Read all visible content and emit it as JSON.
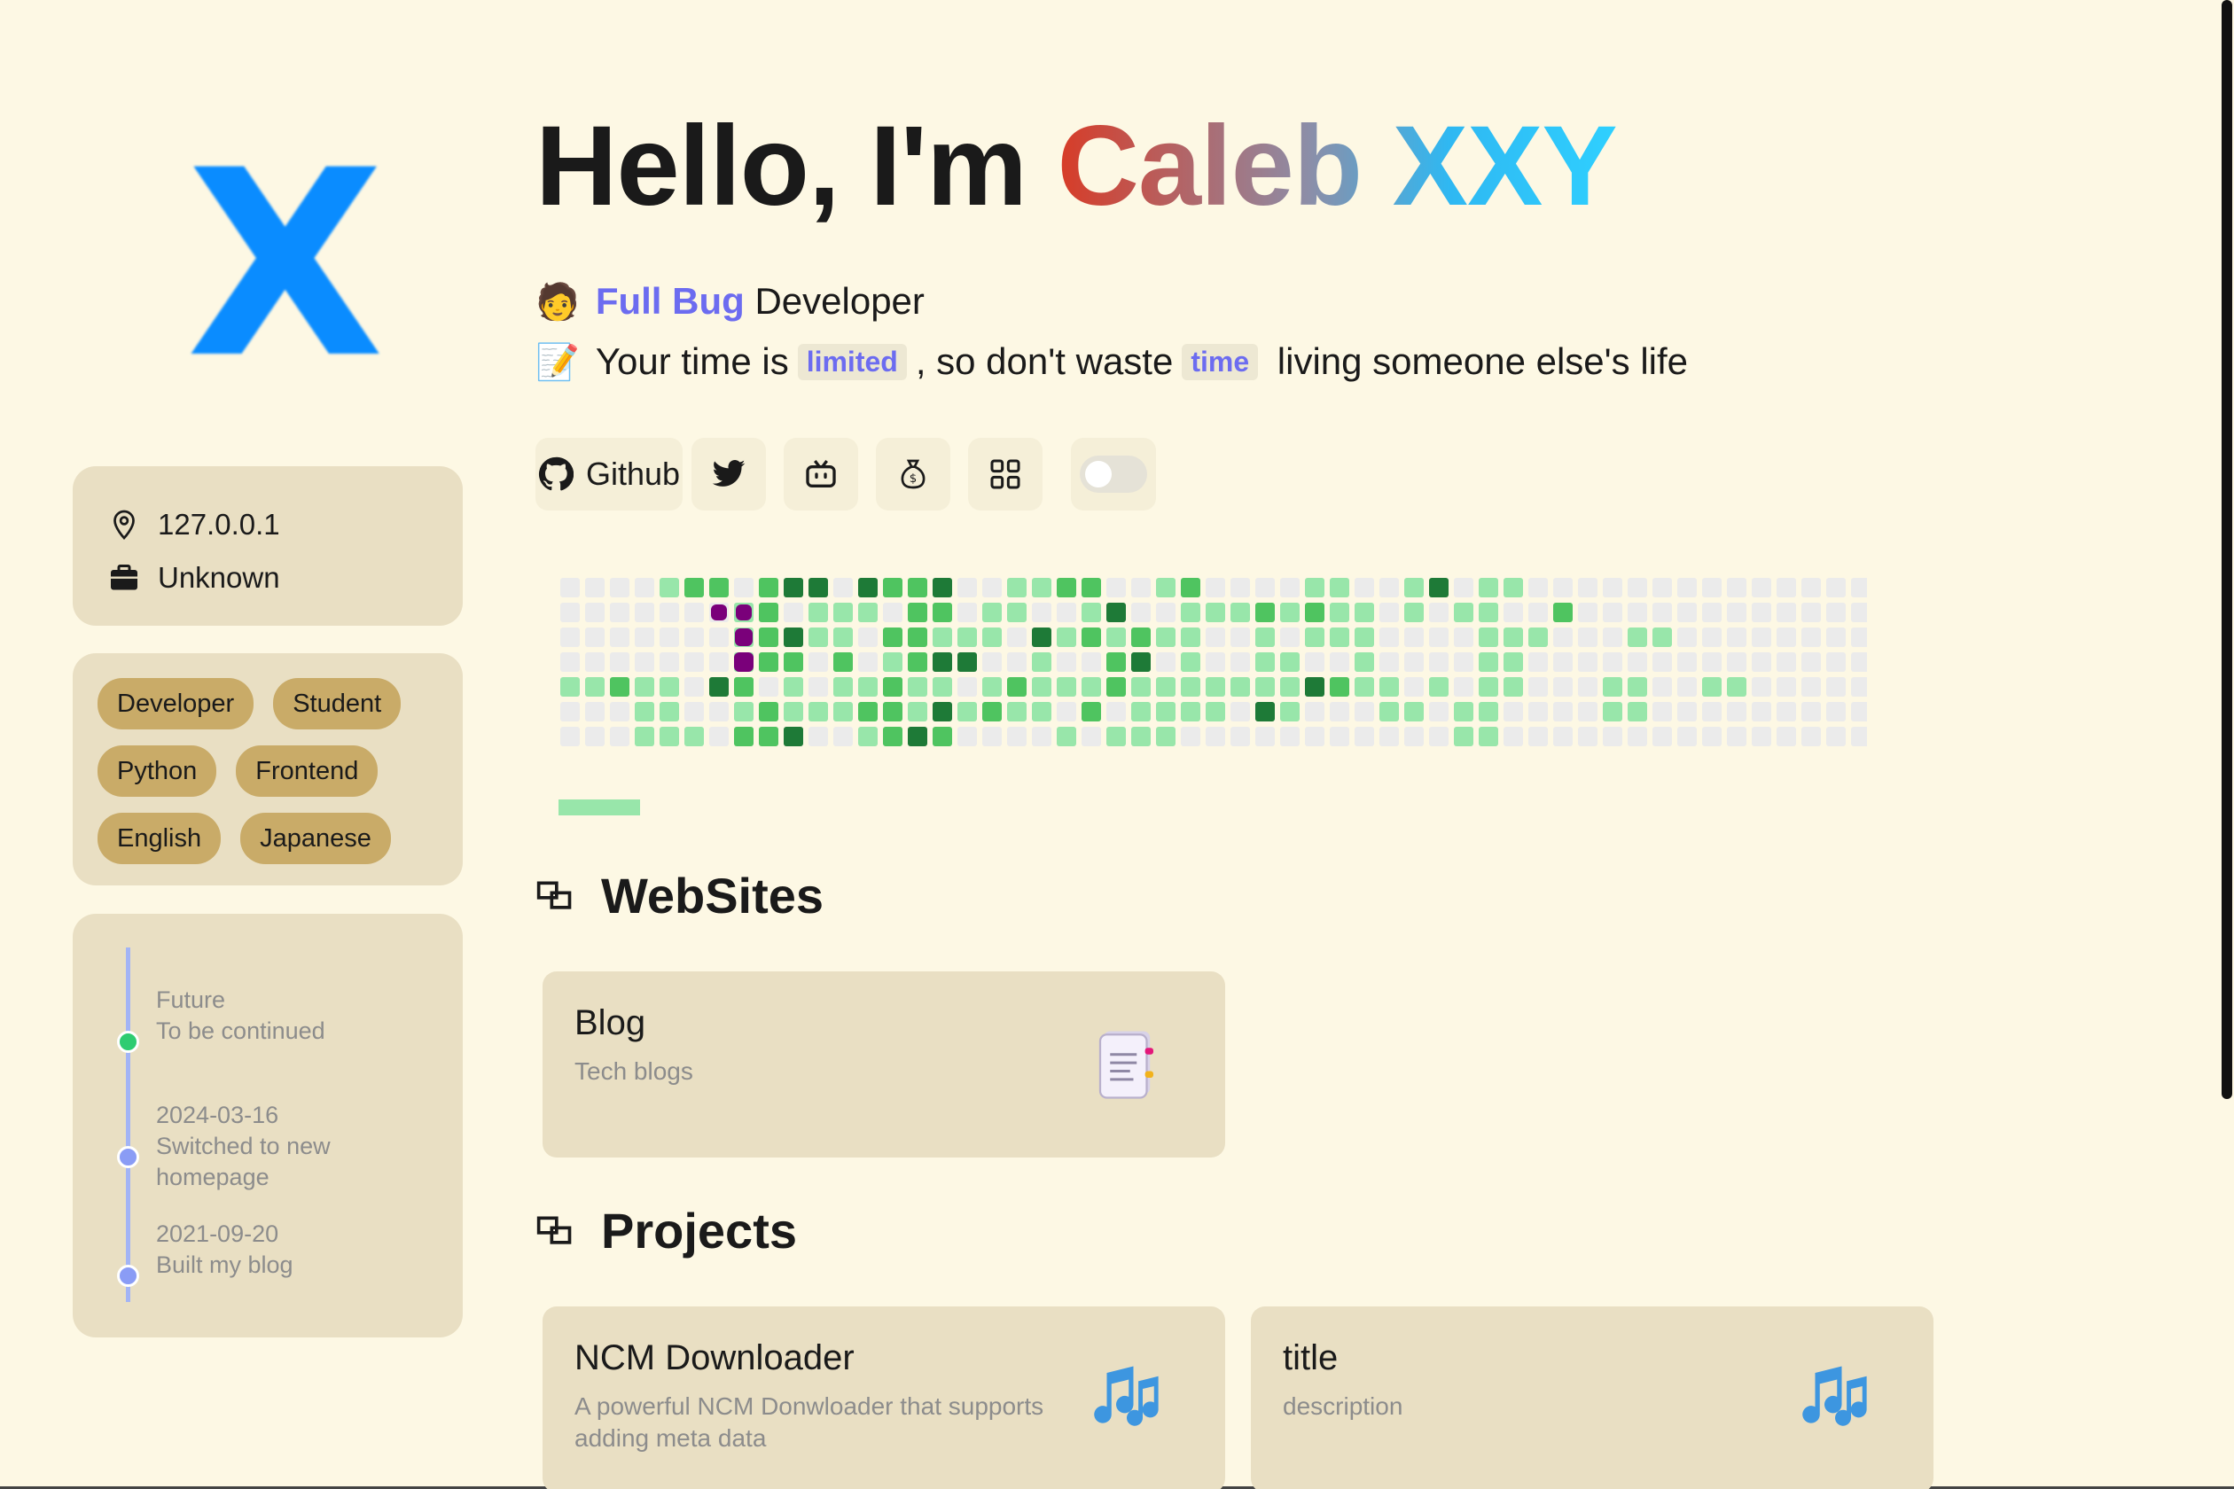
{
  "logo": {
    "letter": "X",
    "color": "#0a8cff"
  },
  "info": {
    "location": "127.0.0.1",
    "job": "Unknown",
    "location_icon": "location-pin-icon",
    "job_icon": "briefcase-icon"
  },
  "tags": [
    "Developer",
    "Student",
    "Python",
    "Frontend",
    "English",
    "Japanese"
  ],
  "timeline": [
    {
      "date": "Future",
      "text": "To be continued",
      "dot_color": "#2ecc71"
    },
    {
      "date": "2024-03-16",
      "text": "Switched to new homepage",
      "dot_color": "#8a9cf5"
    },
    {
      "date": "2021-09-20",
      "text": "Built my blog",
      "dot_color": "#8a9cf5"
    }
  ],
  "hero": {
    "prefix": "Hello, I'm ",
    "name": "Caleb XXY"
  },
  "tagline": {
    "emoji1": "🧑",
    "accent": "Full Bug",
    "rest": " Developer",
    "emoji2": "📝",
    "quote_a": "Your time is",
    "chip_a": "limited",
    "quote_b": ", so don't waste",
    "chip_b": "time",
    "quote_c": " living someone else's life"
  },
  "social": {
    "github_label": "Github",
    "icons": [
      "github-icon",
      "twitter-icon",
      "bilibili-icon",
      "money-bag-icon",
      "grid-apps-icon",
      "theme-toggle"
    ]
  },
  "colors": {
    "background": "#fdf8e4",
    "card": "#e9dfc3",
    "tag": "#c9ab68",
    "accent": "#6c6cf0",
    "heat_empty": "#ebebeb",
    "heat_l1": "#98e6aa",
    "heat_l2": "#4fc460",
    "heat_l3": "#1e7a37",
    "snake": "#7a007a"
  },
  "heatmap": {
    "rows": [
      "0000122023303223001122001200001100130110000000000000000000000000",
      "0000000120111022011001300111212110101100200000000000000000000000",
      "0000000123110221110312121100101110000111000110000000000000000000",
      "0000000122020123300100230100110010000110000000000000000000000000",
      "1121103201011211012111211111113211010110001100110000000000000000",
      "0001100121112213121102011110310001101100001100000000000000000000",
      "0001110223001232000010111000000000001100000000000000000000000000"
    ]
  },
  "sections": {
    "websites_title": "WebSites",
    "projects_title": "Projects"
  },
  "websites": [
    {
      "title": "Blog",
      "desc": "Tech blogs",
      "icon": "notebook-icon"
    }
  ],
  "projects": [
    {
      "title": "NCM Downloader",
      "desc": "A powerful NCM Donwloader that supports adding meta data",
      "icon": "music-notes-icon"
    },
    {
      "title": "title",
      "desc": "description",
      "icon": "music-notes-icon"
    }
  ]
}
